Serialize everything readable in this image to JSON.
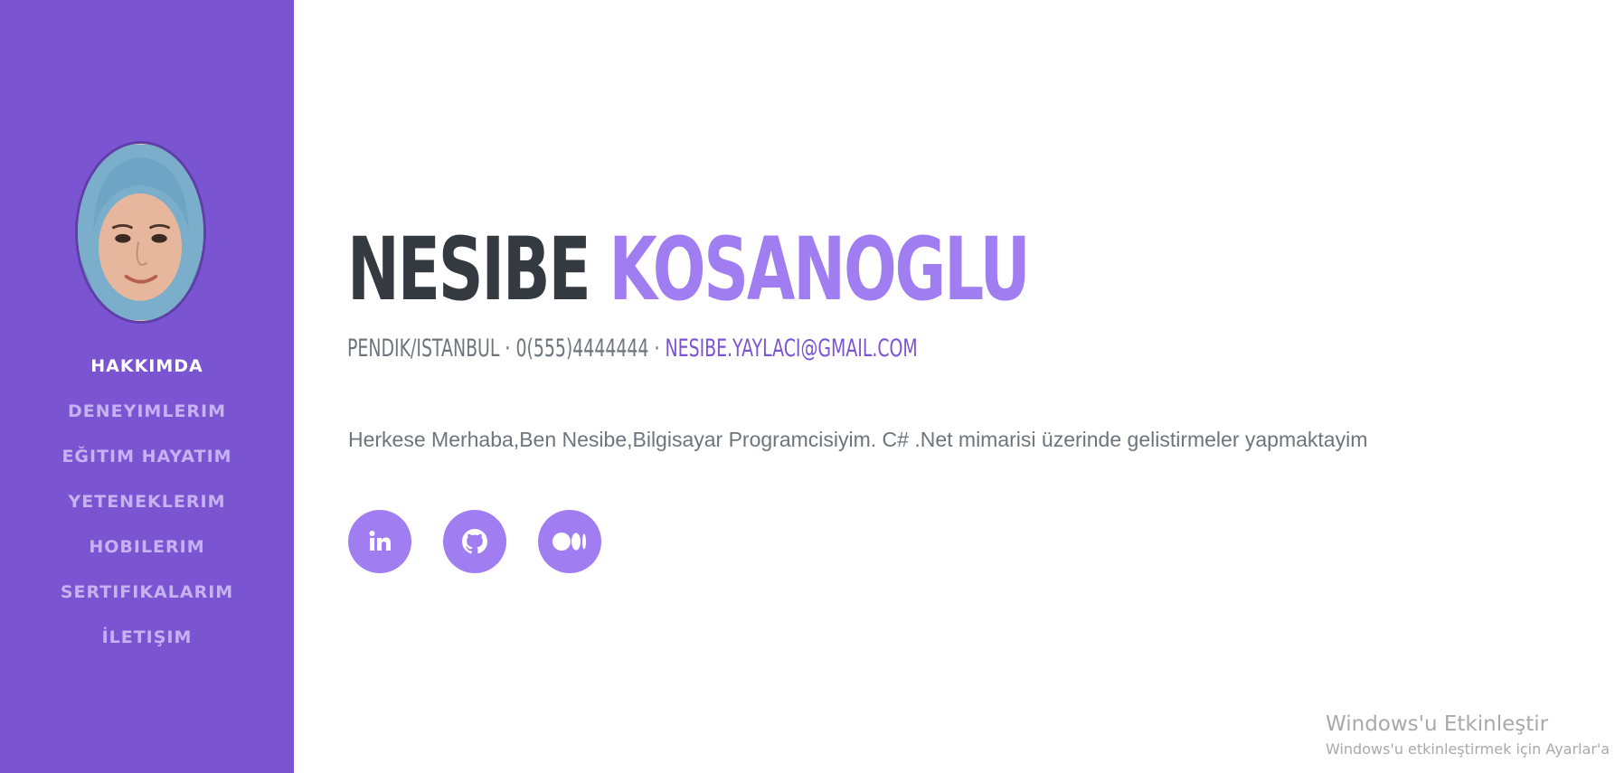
{
  "profile": {
    "avatar_alt": "Profile photo",
    "first_name": "NESIBE",
    "last_name": "KOSANOGLU",
    "location": "PENDIK/ISTANBUL",
    "separator": " · ",
    "phone": "0(555)4444444",
    "email": "NESIBE.YAYLACI@GMAIL.COM",
    "bio": "Herkese Merhaba,Ben Nesibe,Bilgisayar Programcisiyim. C# .Net mimarisi üzerinde gelistirmeler yapmaktayim"
  },
  "nav": {
    "items": [
      {
        "label": "HAKKIMDA",
        "active": true
      },
      {
        "label": "DENEYIMLERIM",
        "active": false
      },
      {
        "label": "EĞITIM HAYATIM",
        "active": false
      },
      {
        "label": "YETENEKLERIM",
        "active": false
      },
      {
        "label": "HOBILERIM",
        "active": false
      },
      {
        "label": "SERTIFIKALARIM",
        "active": false
      },
      {
        "label": "İLETIŞIM",
        "active": false
      }
    ]
  },
  "social": {
    "icons": [
      "linkedin-icon",
      "github-icon",
      "medium-icon"
    ]
  },
  "watermark": {
    "title": "Windows'u Etkinleştir",
    "subtitle": "Windows'u etkinleştirmek için Ayarlar'a g"
  },
  "colors": {
    "sidebar": "#7b54d1",
    "accent": "#a07df1",
    "nav_inactive": "#c7b2f1",
    "text_dark": "#343a40",
    "text_muted": "#6c757d"
  }
}
